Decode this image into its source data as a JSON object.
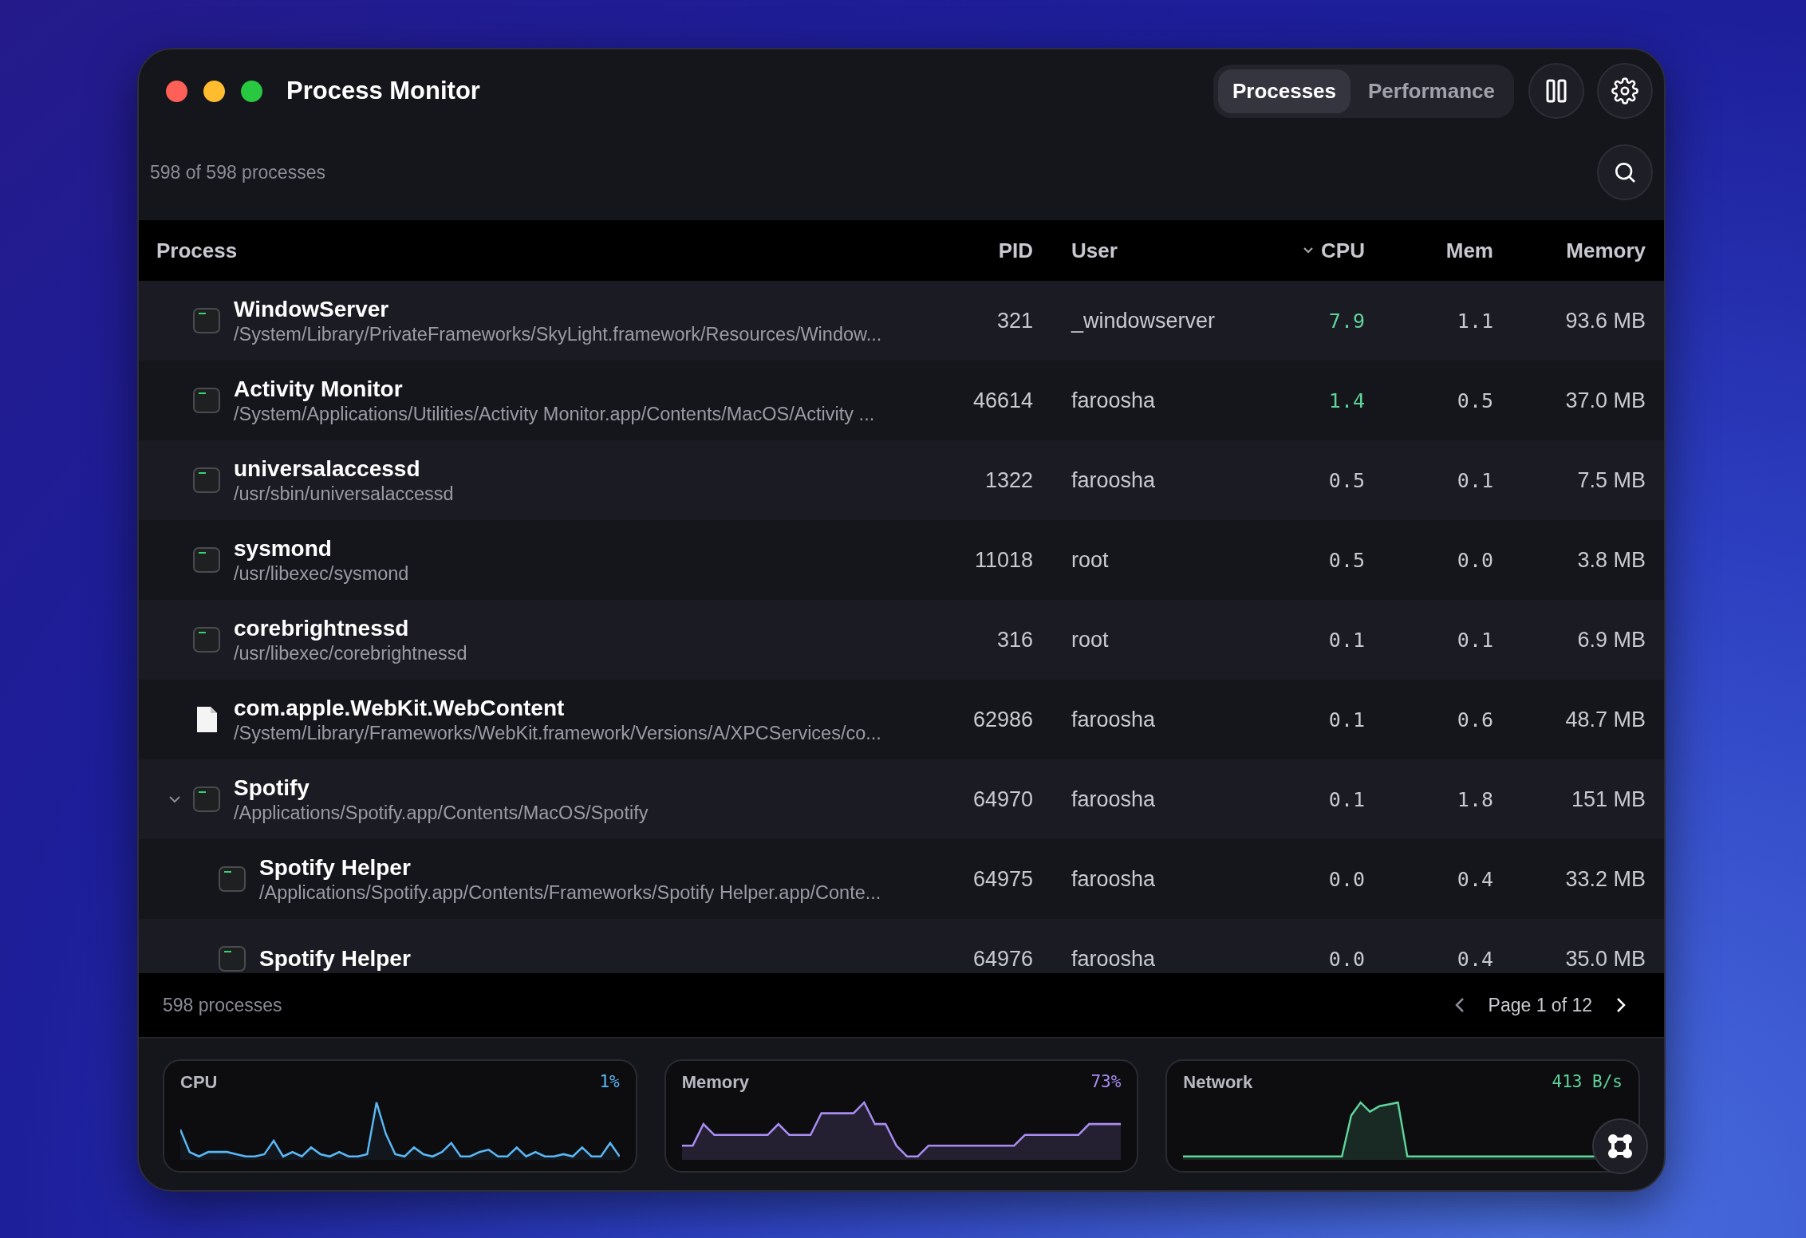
{
  "window": {
    "title": "Process Monitor"
  },
  "tabs": [
    {
      "label": "Processes",
      "selected": true
    },
    {
      "label": "Performance",
      "selected": false
    }
  ],
  "summary": "598 of 598 processes",
  "columns": [
    {
      "label": "Process",
      "sorted": false
    },
    {
      "label": "PID",
      "sorted": false
    },
    {
      "label": "User",
      "sorted": false
    },
    {
      "label": "CPU",
      "sorted": true
    },
    {
      "label": "Mem",
      "sorted": false
    },
    {
      "label": "Memory",
      "sorted": false
    }
  ],
  "rows": [
    {
      "kind": "exec",
      "name": "WindowServer",
      "path": "/System/Library/PrivateFrameworks/SkyLight.framework/Resources/Window...",
      "pid": "321",
      "user": "_windowserver",
      "cpu": "7.9",
      "cpu_active": true,
      "mem": "1.1",
      "memory": "93.6 MB"
    },
    {
      "kind": "exec",
      "name": "Activity Monitor",
      "path": "/System/Applications/Utilities/Activity Monitor.app/Contents/MacOS/Activity ...",
      "pid": "46614",
      "user": "faroosha",
      "cpu": "1.4",
      "cpu_active": true,
      "mem": "0.5",
      "memory": "37.0 MB"
    },
    {
      "kind": "exec",
      "name": "universalaccessd",
      "path": "/usr/sbin/universalaccessd",
      "pid": "1322",
      "user": "faroosha",
      "cpu": "0.5",
      "cpu_active": false,
      "mem": "0.1",
      "memory": "7.5 MB"
    },
    {
      "kind": "exec",
      "name": "sysmond",
      "path": "/usr/libexec/sysmond",
      "pid": "11018",
      "user": "root",
      "cpu": "0.5",
      "cpu_active": false,
      "mem": "0.0",
      "memory": "3.8 MB"
    },
    {
      "kind": "exec",
      "name": "corebrightnessd",
      "path": "/usr/libexec/corebrightnessd",
      "pid": "316",
      "user": "root",
      "cpu": "0.1",
      "cpu_active": false,
      "mem": "0.1",
      "memory": "6.9 MB"
    },
    {
      "kind": "document",
      "name": "com.apple.WebKit.WebContent",
      "path": "/System/Library/Frameworks/WebKit.framework/Versions/A/XPCServices/co...",
      "pid": "62986",
      "user": "faroosha",
      "cpu": "0.1",
      "cpu_active": false,
      "mem": "0.6",
      "memory": "48.7 MB"
    },
    {
      "kind": "exec",
      "name": "Spotify",
      "path": "/Applications/Spotify.app/Contents/MacOS/Spotify",
      "pid": "64970",
      "user": "faroosha",
      "cpu": "0.1",
      "cpu_active": false,
      "mem": "1.8",
      "memory": "151 MB",
      "expanded": true,
      "children": [
        {
          "kind": "exec",
          "name": "Spotify Helper",
          "path": "/Applications/Spotify.app/Contents/Frameworks/Spotify Helper.app/Conte...",
          "pid": "64975",
          "user": "faroosha",
          "cpu": "0.0",
          "cpu_active": false,
          "mem": "0.4",
          "memory": "33.2 MB"
        },
        {
          "kind": "exec",
          "name": "Spotify Helper",
          "pid": "64976",
          "user": "faroosha",
          "cpu": "0.0",
          "cpu_active": false,
          "mem": "0.4",
          "memory": "35.0 MB"
        }
      ]
    }
  ],
  "footer": {
    "count": "598 processes",
    "page": "Page 1 of 12"
  },
  "cards": [
    {
      "kind": "cpu",
      "label": "CPU",
      "value": "1%",
      "color": "#5ab8f5"
    },
    {
      "kind": "memory",
      "label": "Memory",
      "value": "73%",
      "color": "#a98cf0"
    },
    {
      "kind": "network",
      "label": "Network",
      "value": "413 B/s",
      "color": "#5fd39a"
    }
  ]
}
